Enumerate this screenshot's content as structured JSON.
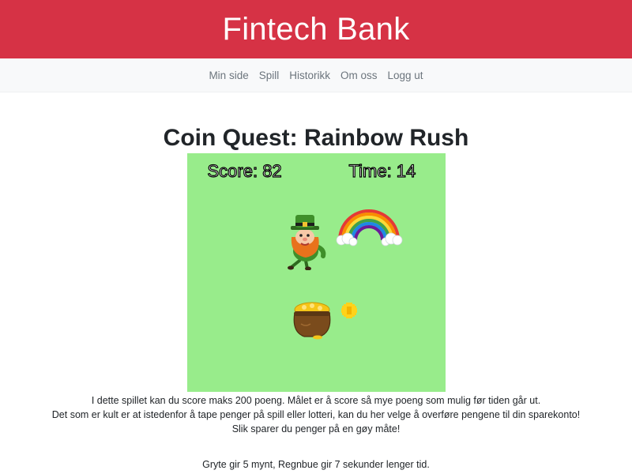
{
  "header": {
    "brand": "Fintech Bank"
  },
  "nav": {
    "items": [
      {
        "label": "Min side"
      },
      {
        "label": "Spill"
      },
      {
        "label": "Historikk"
      },
      {
        "label": "Om oss"
      },
      {
        "label": "Logg ut"
      }
    ]
  },
  "game": {
    "title": "Coin Quest: Rainbow Rush",
    "score_text": "Score: 82",
    "time_text": "Time: 14",
    "sprites": [
      "leprechaun-sprite",
      "rainbow-sprite",
      "pot-of-gold-sprite",
      "gold-coin-sprite"
    ],
    "colors": {
      "canvas_bg": "#98ec8b",
      "brand_red": "#d63245"
    }
  },
  "description": {
    "line1": "I dette spillet kan du score maks 200 poeng. Målet er å score så mye poeng som mulig før tiden går ut.",
    "line2": "Det som er kult er at istedenfor å tape penger på spill eller lotteri, kan du her velge å overføre pengene til din sparekonto!",
    "line3": "Slik sparer du penger på en gøy måte!"
  },
  "rules": "Gryte gir 5 mynt, Regnbue gir 7 sekunder lenger tid."
}
